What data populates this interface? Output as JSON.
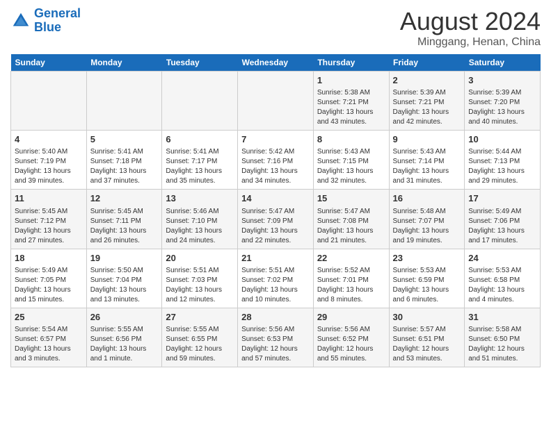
{
  "logo": {
    "line1": "General",
    "line2": "Blue"
  },
  "title": "August 2024",
  "subtitle": "Minggang, Henan, China",
  "days_of_week": [
    "Sunday",
    "Monday",
    "Tuesday",
    "Wednesday",
    "Thursday",
    "Friday",
    "Saturday"
  ],
  "weeks": [
    [
      {
        "day": "",
        "info": ""
      },
      {
        "day": "",
        "info": ""
      },
      {
        "day": "",
        "info": ""
      },
      {
        "day": "",
        "info": ""
      },
      {
        "day": "1",
        "info": "Sunrise: 5:38 AM\nSunset: 7:21 PM\nDaylight: 13 hours\nand 43 minutes."
      },
      {
        "day": "2",
        "info": "Sunrise: 5:39 AM\nSunset: 7:21 PM\nDaylight: 13 hours\nand 42 minutes."
      },
      {
        "day": "3",
        "info": "Sunrise: 5:39 AM\nSunset: 7:20 PM\nDaylight: 13 hours\nand 40 minutes."
      }
    ],
    [
      {
        "day": "4",
        "info": "Sunrise: 5:40 AM\nSunset: 7:19 PM\nDaylight: 13 hours\nand 39 minutes."
      },
      {
        "day": "5",
        "info": "Sunrise: 5:41 AM\nSunset: 7:18 PM\nDaylight: 13 hours\nand 37 minutes."
      },
      {
        "day": "6",
        "info": "Sunrise: 5:41 AM\nSunset: 7:17 PM\nDaylight: 13 hours\nand 35 minutes."
      },
      {
        "day": "7",
        "info": "Sunrise: 5:42 AM\nSunset: 7:16 PM\nDaylight: 13 hours\nand 34 minutes."
      },
      {
        "day": "8",
        "info": "Sunrise: 5:43 AM\nSunset: 7:15 PM\nDaylight: 13 hours\nand 32 minutes."
      },
      {
        "day": "9",
        "info": "Sunrise: 5:43 AM\nSunset: 7:14 PM\nDaylight: 13 hours\nand 31 minutes."
      },
      {
        "day": "10",
        "info": "Sunrise: 5:44 AM\nSunset: 7:13 PM\nDaylight: 13 hours\nand 29 minutes."
      }
    ],
    [
      {
        "day": "11",
        "info": "Sunrise: 5:45 AM\nSunset: 7:12 PM\nDaylight: 13 hours\nand 27 minutes."
      },
      {
        "day": "12",
        "info": "Sunrise: 5:45 AM\nSunset: 7:11 PM\nDaylight: 13 hours\nand 26 minutes."
      },
      {
        "day": "13",
        "info": "Sunrise: 5:46 AM\nSunset: 7:10 PM\nDaylight: 13 hours\nand 24 minutes."
      },
      {
        "day": "14",
        "info": "Sunrise: 5:47 AM\nSunset: 7:09 PM\nDaylight: 13 hours\nand 22 minutes."
      },
      {
        "day": "15",
        "info": "Sunrise: 5:47 AM\nSunset: 7:08 PM\nDaylight: 13 hours\nand 21 minutes."
      },
      {
        "day": "16",
        "info": "Sunrise: 5:48 AM\nSunset: 7:07 PM\nDaylight: 13 hours\nand 19 minutes."
      },
      {
        "day": "17",
        "info": "Sunrise: 5:49 AM\nSunset: 7:06 PM\nDaylight: 13 hours\nand 17 minutes."
      }
    ],
    [
      {
        "day": "18",
        "info": "Sunrise: 5:49 AM\nSunset: 7:05 PM\nDaylight: 13 hours\nand 15 minutes."
      },
      {
        "day": "19",
        "info": "Sunrise: 5:50 AM\nSunset: 7:04 PM\nDaylight: 13 hours\nand 13 minutes."
      },
      {
        "day": "20",
        "info": "Sunrise: 5:51 AM\nSunset: 7:03 PM\nDaylight: 13 hours\nand 12 minutes."
      },
      {
        "day": "21",
        "info": "Sunrise: 5:51 AM\nSunset: 7:02 PM\nDaylight: 13 hours\nand 10 minutes."
      },
      {
        "day": "22",
        "info": "Sunrise: 5:52 AM\nSunset: 7:01 PM\nDaylight: 13 hours\nand 8 minutes."
      },
      {
        "day": "23",
        "info": "Sunrise: 5:53 AM\nSunset: 6:59 PM\nDaylight: 13 hours\nand 6 minutes."
      },
      {
        "day": "24",
        "info": "Sunrise: 5:53 AM\nSunset: 6:58 PM\nDaylight: 13 hours\nand 4 minutes."
      }
    ],
    [
      {
        "day": "25",
        "info": "Sunrise: 5:54 AM\nSunset: 6:57 PM\nDaylight: 13 hours\nand 3 minutes."
      },
      {
        "day": "26",
        "info": "Sunrise: 5:55 AM\nSunset: 6:56 PM\nDaylight: 13 hours\nand 1 minute."
      },
      {
        "day": "27",
        "info": "Sunrise: 5:55 AM\nSunset: 6:55 PM\nDaylight: 12 hours\nand 59 minutes."
      },
      {
        "day": "28",
        "info": "Sunrise: 5:56 AM\nSunset: 6:53 PM\nDaylight: 12 hours\nand 57 minutes."
      },
      {
        "day": "29",
        "info": "Sunrise: 5:56 AM\nSunset: 6:52 PM\nDaylight: 12 hours\nand 55 minutes."
      },
      {
        "day": "30",
        "info": "Sunrise: 5:57 AM\nSunset: 6:51 PM\nDaylight: 12 hours\nand 53 minutes."
      },
      {
        "day": "31",
        "info": "Sunrise: 5:58 AM\nSunset: 6:50 PM\nDaylight: 12 hours\nand 51 minutes."
      }
    ]
  ]
}
